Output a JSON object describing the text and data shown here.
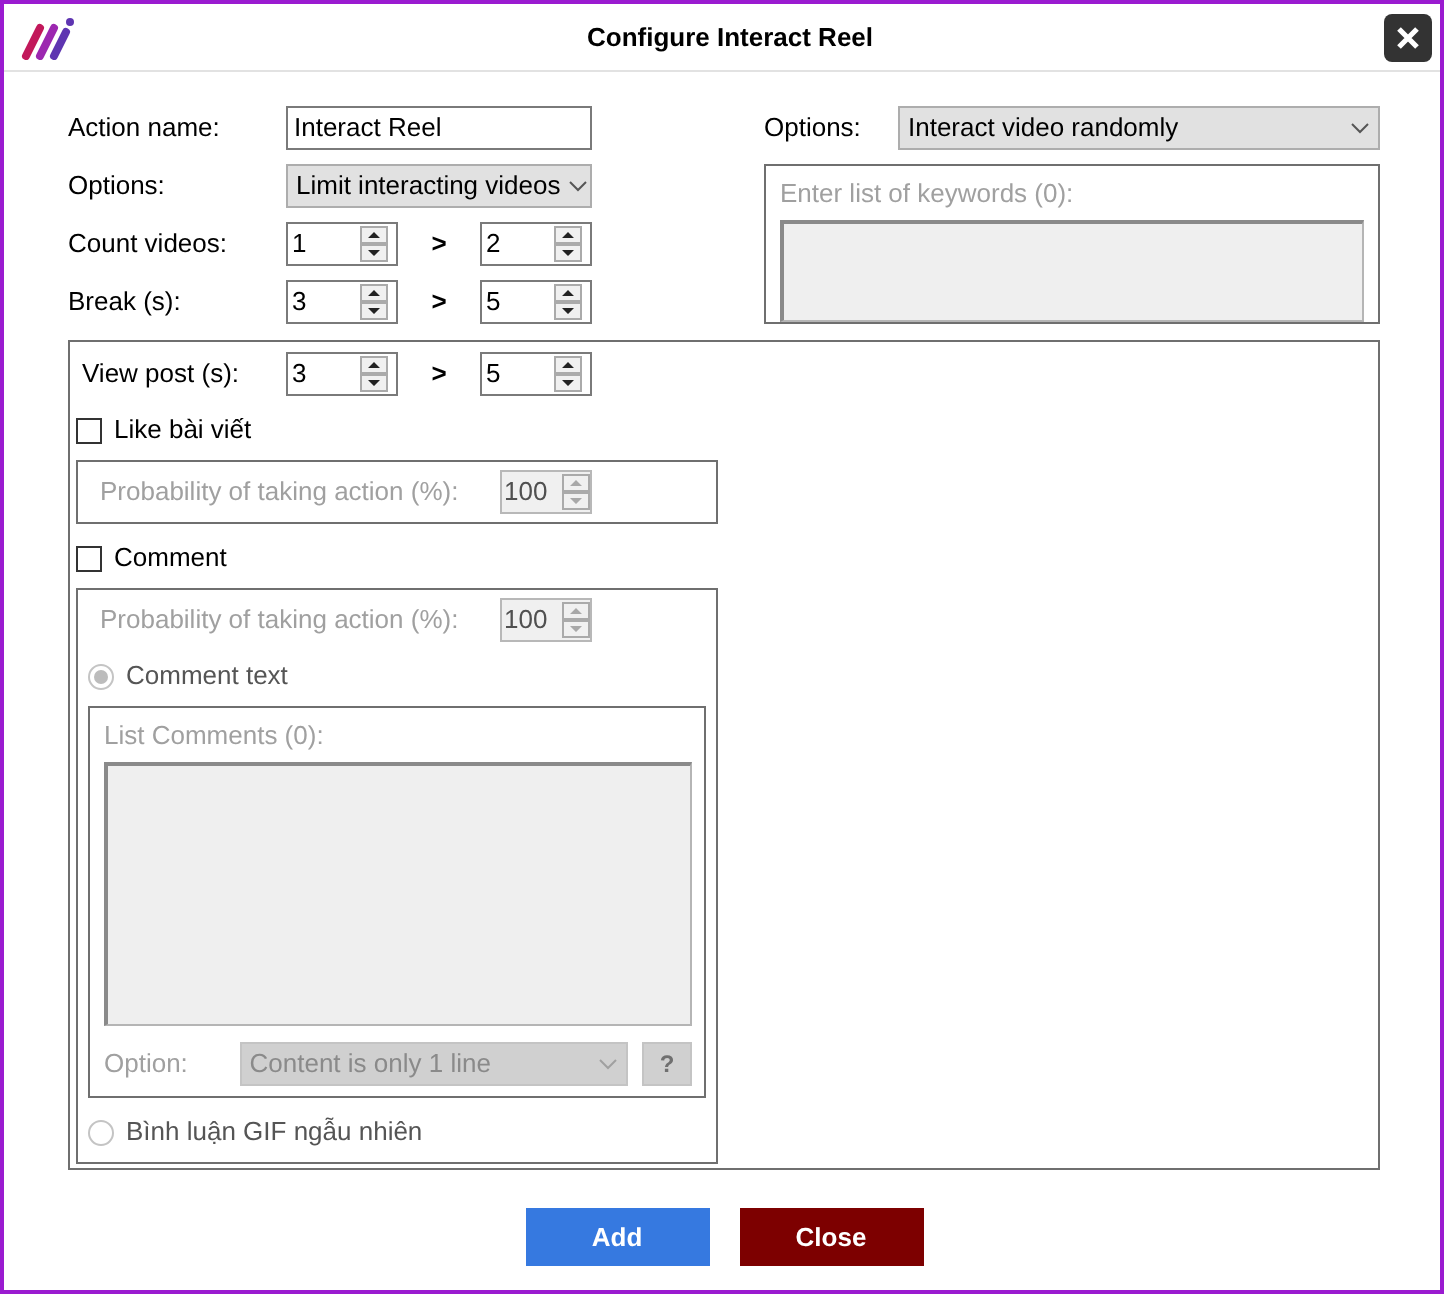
{
  "window": {
    "title": "Configure Interact Reel"
  },
  "action_name": {
    "label": "Action name:",
    "value": "Interact Reel"
  },
  "options_left": {
    "label": "Options:",
    "value": "Limit interacting videos"
  },
  "ranges": [
    {
      "label": "Count videos:",
      "from": "1",
      "separator": ">",
      "to": "2"
    },
    {
      "label": "Break (s):",
      "from": "3",
      "separator": ">",
      "to": "5"
    }
  ],
  "options_right": {
    "label": "Options:",
    "value": "Interact video randomly"
  },
  "keywords": {
    "label": "Enter list of keywords (0):",
    "disabled": true
  },
  "view_post": {
    "label": "View post (s):",
    "from": "3",
    "separator": ">",
    "to": "5"
  },
  "like": {
    "label": "Like bài viết",
    "checked": false,
    "probability": {
      "label": "Probability of taking action (%):",
      "value": "100"
    }
  },
  "comment": {
    "label": "Comment",
    "checked": false,
    "probability": {
      "label": "Probability of taking action (%):",
      "value": "100"
    },
    "modes": [
      {
        "label": "Comment text",
        "selected": true
      },
      {
        "label": "Bình luận GIF ngẫu nhiên",
        "selected": false
      }
    ],
    "list": {
      "label": "List Comments (0):"
    },
    "option": {
      "label": "Option:",
      "value": "Content is only 1 line"
    },
    "help": "?"
  },
  "buttons": [
    {
      "label": "Add",
      "kind": "primary"
    },
    {
      "label": "Close",
      "kind": "danger"
    }
  ]
}
